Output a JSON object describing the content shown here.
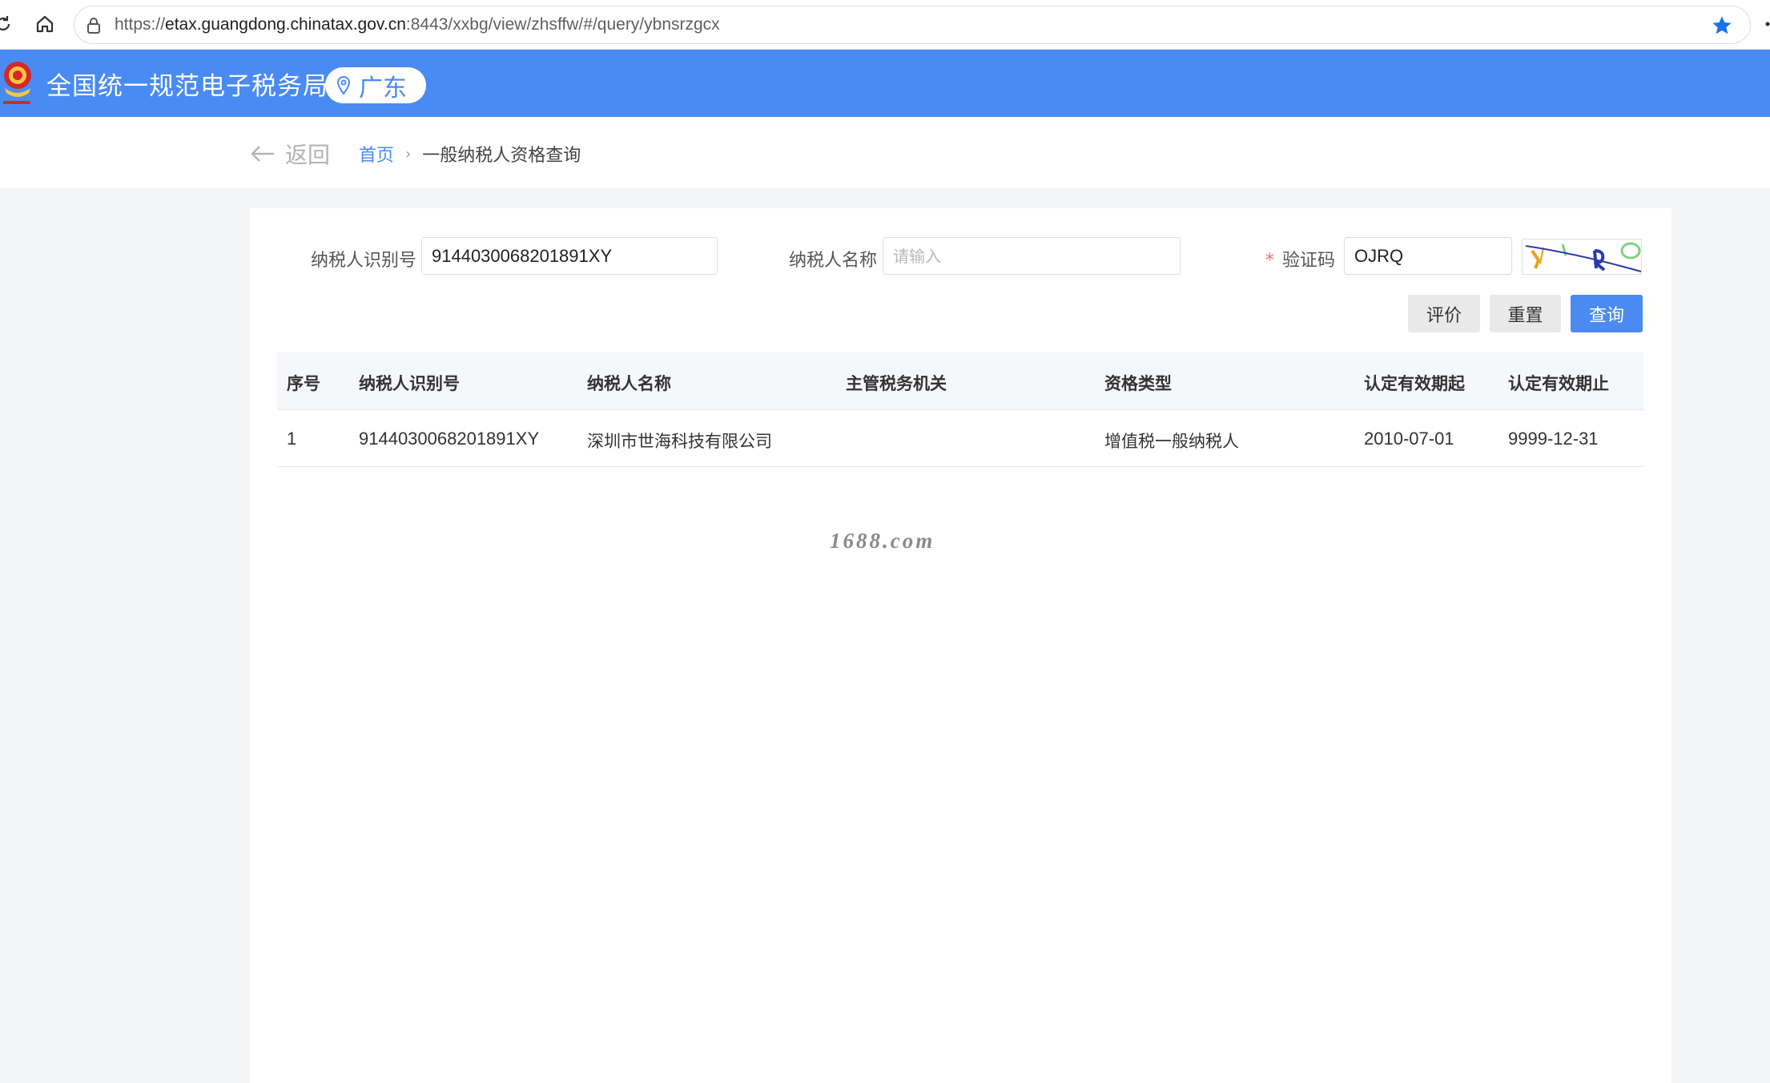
{
  "browser": {
    "url_prefix": "https://",
    "url_host": "etax.guangdong.chinatax.gov.cn",
    "url_path": ":8443/xxbg/view/zhsffw/#/query/ybnsrzgcx"
  },
  "header": {
    "title": "全国统一规范电子税务局",
    "region": "广东",
    "brand_color": "#4a8bf3"
  },
  "breadcrumb": {
    "back_label": "返回",
    "home": "首页",
    "separator": "›",
    "current": "一般纳税人资格查询"
  },
  "form": {
    "taxpayer_id_label": "纳税人识别号",
    "taxpayer_id_value": "9144030068201891XY",
    "taxpayer_name_label": "纳税人名称",
    "taxpayer_name_placeholder": "请输入",
    "captcha_required_mark": "*",
    "captcha_label": "验证码",
    "captcha_value": "OJRQ",
    "evaluate_label": "评价",
    "reset_label": "重置",
    "query_label": "查询"
  },
  "table": {
    "columns": [
      "序号",
      "纳税人识别号",
      "纳税人名称",
      "主管税务机关",
      "资格类型",
      "认定有效期起",
      "认定有效期止"
    ],
    "rows": [
      [
        "1",
        "9144030068201891XY",
        "深圳市世海科技有限公司",
        "",
        "增值税一般纳税人",
        "2010-07-01",
        "9999-12-31"
      ]
    ]
  },
  "watermark": "1688.com"
}
